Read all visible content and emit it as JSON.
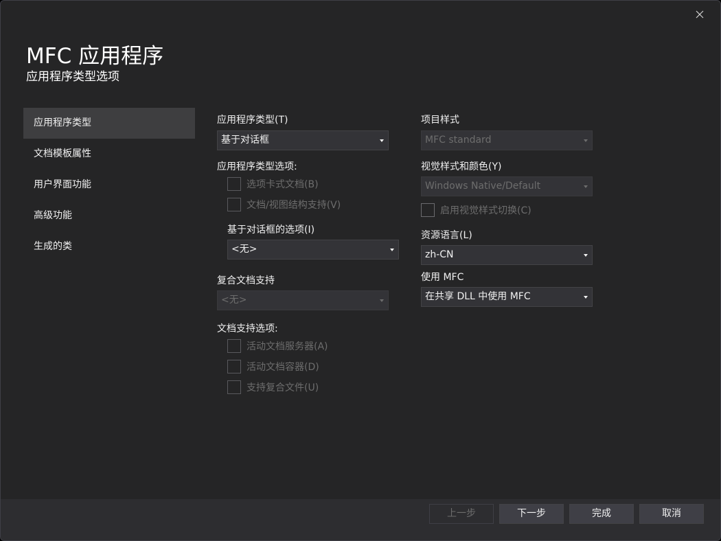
{
  "header": {
    "title": "MFC 应用程序",
    "subtitle": "应用程序类型选项",
    "close_icon": "close-icon"
  },
  "sidebar": {
    "items": [
      {
        "label": "应用程序类型",
        "active": true
      },
      {
        "label": "文档模板属性",
        "active": false
      },
      {
        "label": "用户界面功能",
        "active": false
      },
      {
        "label": "高级功能",
        "active": false
      },
      {
        "label": "生成的类",
        "active": false
      }
    ]
  },
  "left_column": {
    "app_type_label": "应用程序类型(T)",
    "app_type_value": "基于对话框",
    "app_type_options_label": "应用程序类型选项:",
    "tabbed_docs": "选项卡式文档(B)",
    "doc_view": "文档/视图结构支持(V)",
    "dialog_options_label": "基于对话框的选项(I)",
    "dialog_options_value": "<无>",
    "compound_doc_label": "复合文档支持",
    "compound_doc_value": "<无>",
    "doc_support_label": "文档支持选项:",
    "active_doc_server": "活动文档服务器(A)",
    "active_doc_container": "活动文档容器(D)",
    "compound_files": "支持复合文件(U)"
  },
  "right_column": {
    "project_style_label": "项目样式",
    "project_style_value": "MFC standard",
    "visual_style_label": "视觉样式和颜色(Y)",
    "visual_style_value": "Windows Native/Default",
    "enable_visual_switch": "启用视觉样式切换(C)",
    "resource_lang_label": "资源语言(L)",
    "resource_lang_value": "zh-CN",
    "use_mfc_label": "使用 MFC",
    "use_mfc_value": "在共享 DLL 中使用 MFC"
  },
  "footer": {
    "back": "上一步",
    "next": "下一步",
    "finish": "完成",
    "cancel": "取消"
  }
}
